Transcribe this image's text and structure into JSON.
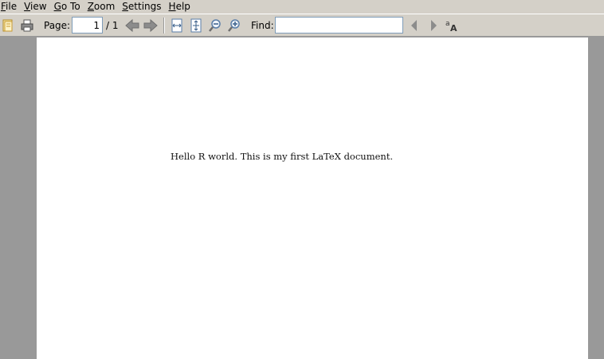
{
  "menu": {
    "items": [
      {
        "pre": "",
        "u": "F",
        "post": "ile"
      },
      {
        "pre": "",
        "u": "V",
        "post": "iew"
      },
      {
        "pre": "",
        "u": "G",
        "post": "o To"
      },
      {
        "pre": "",
        "u": "Z",
        "post": "oom"
      },
      {
        "pre": "",
        "u": "S",
        "post": "ettings"
      },
      {
        "pre": "",
        "u": "H",
        "post": "elp"
      }
    ]
  },
  "toolbar": {
    "page_label": "Page:",
    "page_value": "1",
    "page_total": "/ 1",
    "find_label": "Find:",
    "find_value": "",
    "icons": [
      "open-icon",
      "print-icon",
      "previous-page-icon",
      "next-page-icon",
      "fit-width-icon",
      "fit-page-icon",
      "zoom-out-icon",
      "zoom-in-icon",
      "find-previous-icon",
      "find-next-icon",
      "match-case-icon"
    ]
  },
  "document": {
    "text": "Hello R world. This is my first LaTeX document."
  }
}
